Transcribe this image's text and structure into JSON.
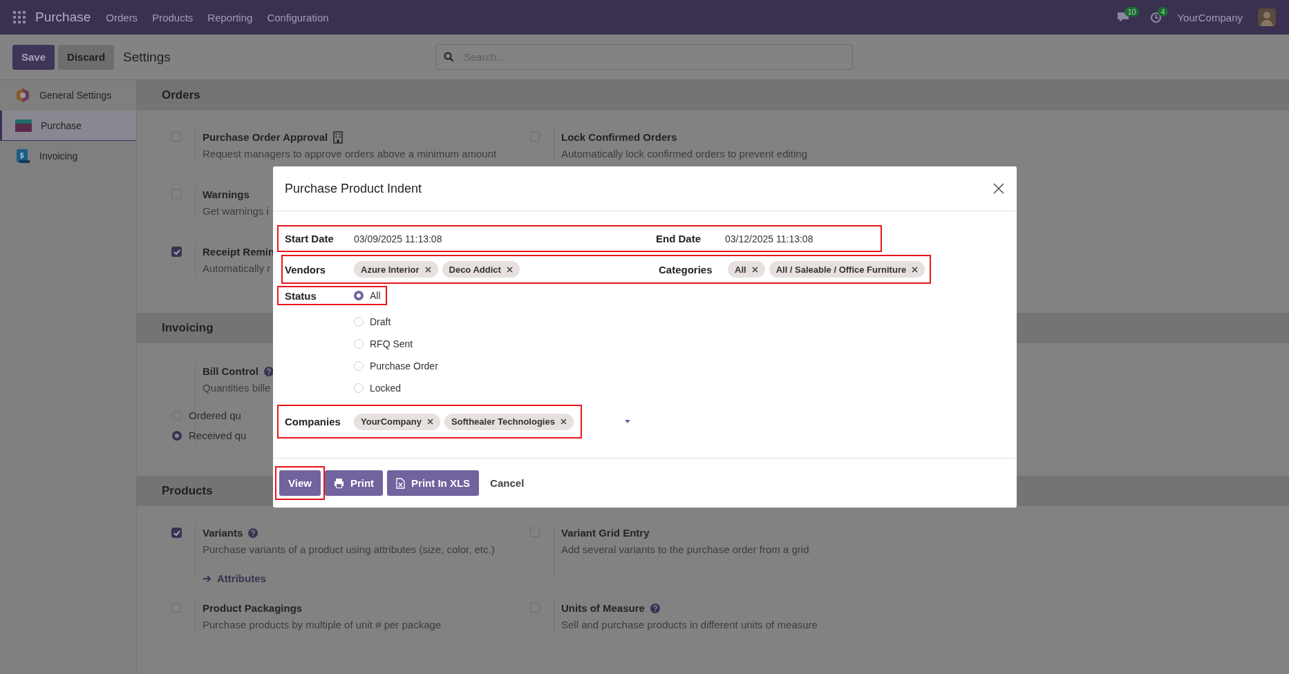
{
  "navbar": {
    "app": "Purchase",
    "menu": [
      {
        "label": "Orders"
      },
      {
        "label": "Products"
      },
      {
        "label": "Reporting"
      },
      {
        "label": "Configuration"
      }
    ],
    "messages_badge": "10",
    "activities_badge": "4",
    "company": "YourCompany"
  },
  "control_panel": {
    "buttons": [
      {
        "label": "Save",
        "kind": "primary"
      },
      {
        "label": "Discard",
        "kind": "secondary"
      }
    ],
    "title": "Settings",
    "search": {
      "placeholder": "Search..."
    }
  },
  "sidebar": {
    "items": [
      {
        "label": "General Settings",
        "kind": "general",
        "selected": false
      },
      {
        "label": "Purchase",
        "kind": "purchase",
        "selected": true
      },
      {
        "label": "Invoicing",
        "kind": "invoicing",
        "selected": false
      }
    ]
  },
  "sections": [
    {
      "title": "Orders",
      "rows": [
        [
          {
            "title": "Purchase Order Approval",
            "company_icon": true,
            "description": "Request managers to approve orders above a minimum amount",
            "checked": false
          },
          {
            "title": "Lock Confirmed Orders",
            "description": "Automatically lock confirmed orders to prevent editing",
            "checked": false
          }
        ],
        [
          {
            "title": "Warnings",
            "description": "Get warnings i",
            "checked": false
          }
        ],
        [
          {
            "title": "Receipt Remin",
            "description": "Automatically r",
            "checked": true
          }
        ]
      ]
    },
    {
      "title": "Invoicing",
      "rows": [
        [
          {
            "title": "Bill Control",
            "help": true,
            "description": "Quantities bille",
            "options": [
              {
                "label": "Ordered qu",
                "selected": false
              },
              {
                "label": "Received qu",
                "selected": true
              }
            ]
          }
        ]
      ]
    },
    {
      "title": "Products",
      "rows": [
        [
          {
            "title": "Variants",
            "help": true,
            "description": "Purchase variants of a product using attributes (size, color, etc.)",
            "checked": true,
            "link": "Attributes"
          },
          {
            "title": "Variant Grid Entry",
            "description": "Add several variants to the purchase order from a grid",
            "checked": false
          }
        ],
        [
          {
            "title": "Product Packagings",
            "description": "Purchase products by multiple of unit # per package",
            "checked": false
          },
          {
            "title": "Units of Measure",
            "help": true,
            "description": "Sell and purchase products in different units of measure",
            "checked": false
          }
        ]
      ]
    }
  ],
  "dialog": {
    "title": "Purchase Product Indent",
    "dates": {
      "highlighted": true,
      "start": {
        "label": "Start Date",
        "value": "03/09/2025 11:13:08"
      },
      "end": {
        "label": "End Date",
        "value": "03/12/2025 11:13:08"
      }
    },
    "tags": {
      "highlighted": true,
      "vendors": {
        "label": "Vendors",
        "tags": [
          "Azure Interior",
          "Deco Addict"
        ]
      },
      "categories": {
        "label": "Categories",
        "tags": [
          "All",
          "All / Saleable / Office Furniture"
        ]
      }
    },
    "status": {
      "highlighted": true,
      "label": "Status",
      "options": [
        {
          "label": "All",
          "selected": true
        },
        {
          "label": "Draft",
          "selected": false
        },
        {
          "label": "RFQ Sent",
          "selected": false
        },
        {
          "label": "Purchase Order",
          "selected": false
        },
        {
          "label": "Locked",
          "selected": false
        }
      ]
    },
    "companies": {
      "highlighted": true,
      "label": "Companies",
      "tags": [
        "YourCompany",
        "Softhealer Technologies"
      ]
    },
    "buttons": [
      {
        "label": "View",
        "kind": "primary",
        "highlighted": true
      },
      {
        "label": "Print",
        "kind": "print",
        "highlighted": false
      },
      {
        "label": "Print In XLS",
        "kind": "xls",
        "highlighted": false
      },
      {
        "label": "Cancel",
        "kind": "link",
        "highlighted": false
      }
    ]
  }
}
